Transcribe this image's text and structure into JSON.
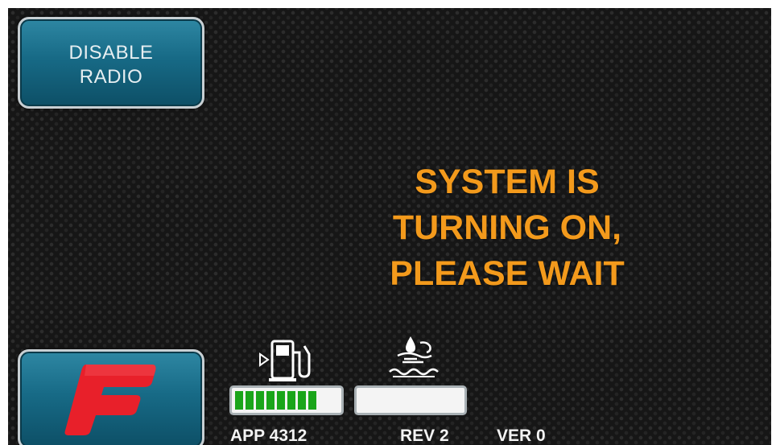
{
  "buttons": {
    "disable_radio": {
      "line1": "DISABLE",
      "line2": "RADIO"
    },
    "brand_logo": {
      "icon": "brand-f-logo-icon",
      "color": "#e8202a"
    }
  },
  "status_message": {
    "line1": "SYSTEM IS",
    "line2": "TURNING ON,",
    "line3": "PLEASE WAIT",
    "color": "#f39a1c"
  },
  "gauges": {
    "fuel": {
      "icon": "fuel-pump-icon",
      "level_fraction": 0.8,
      "fill_color": "#1aa51a"
    },
    "def": {
      "icon": "def-fluid-icon",
      "level_fraction": 0
    }
  },
  "info": {
    "app": "APP  4312",
    "rev": "REV 2",
    "ver": "VER 0"
  },
  "colors": {
    "button_blue": "#176a86",
    "background": "#161616"
  }
}
